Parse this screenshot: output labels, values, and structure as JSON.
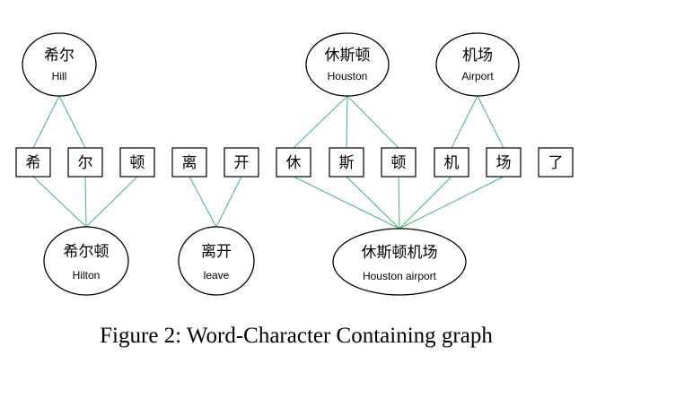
{
  "figure": {
    "caption": "Figure 2: Word-Character Containing graph"
  },
  "characters": [
    "希",
    "尔",
    "顿",
    "离",
    "开",
    "休",
    "斯",
    "顿",
    "机",
    "场",
    "了"
  ],
  "words": [
    {
      "zh": "希尔",
      "en": "Hill",
      "chars": [
        0,
        1
      ]
    },
    {
      "zh": "休斯顿",
      "en": "Houston",
      "chars": [
        5,
        6,
        7
      ]
    },
    {
      "zh": "机场",
      "en": "Airport",
      "chars": [
        8,
        9
      ]
    },
    {
      "zh": "希尔顿",
      "en": "Hilton",
      "chars": [
        0,
        1,
        2
      ]
    },
    {
      "zh": "离开",
      "en": "leave",
      "chars": [
        3,
        4
      ]
    },
    {
      "zh": "休斯顿机场",
      "en": "Houston airport",
      "chars": [
        5,
        6,
        7,
        8,
        9
      ]
    }
  ],
  "colors": {
    "edge": "#3cb878",
    "stroke": "#000000"
  }
}
